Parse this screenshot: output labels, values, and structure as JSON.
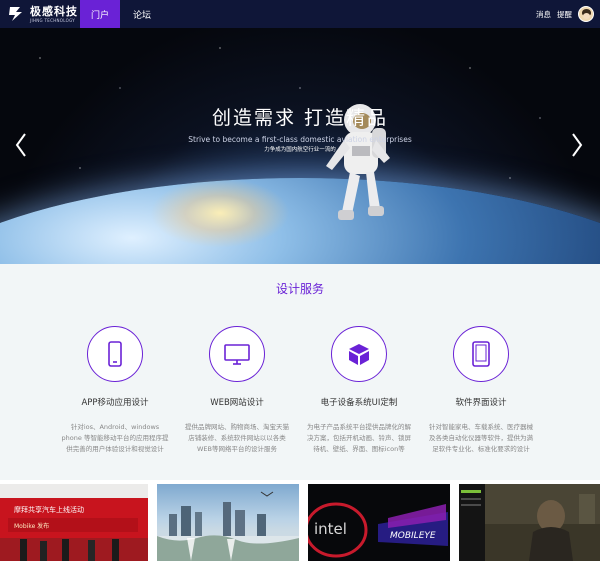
{
  "nav": {
    "logo_cn": "极感科技",
    "logo_en": "JIHNG TECHNOLOGY",
    "tabs": [
      "门户",
      "论坛"
    ],
    "active_tab": "门户",
    "right_links": [
      "消息",
      "提醒"
    ]
  },
  "hero": {
    "title": "创造需求 打造精品",
    "subtitle": "Strive to become a first-class domestic aviation                              enterprises",
    "subtitle2": "力争成为国内航空行业一流的"
  },
  "services": {
    "title": "设计服务",
    "items": [
      {
        "icon": "mobile-icon",
        "title": "APP移动应用设计",
        "desc": "针对ios、Android、windows phone 等智能移动平台的应用程序提供完善的用户体验设计和视觉设计"
      },
      {
        "icon": "monitor-icon",
        "title": "WEB网站设计",
        "desc": "提供品牌网站、购物商场、淘宝天猫店铺装修、系统软件网站以以各类WEB等网络平台的设计服务"
      },
      {
        "icon": "box-icon",
        "title": "电子设备系统UI定制",
        "desc": "为电子产品系统平台提供品牌化的解决方案，包括开机动画、铃声、锁屏待机、壁纸、界面、图标icon等"
      },
      {
        "icon": "tablet-icon",
        "title": "软件界面设计",
        "desc": "针对智能家电、车载系统、医疗器械及各类自动化仪器等软件，提供为满足软件专业化、标准化要求的设计"
      }
    ]
  },
  "thumbs": {
    "t1_text1": "摩拜共享汽车上线活动",
    "t1_text2": "Mobike 发布",
    "t3_text1": "intel",
    "t3_text2": "MOBILEYE"
  },
  "colors": {
    "accent": "#6a22d6",
    "nav_bg": "#0f1638"
  }
}
